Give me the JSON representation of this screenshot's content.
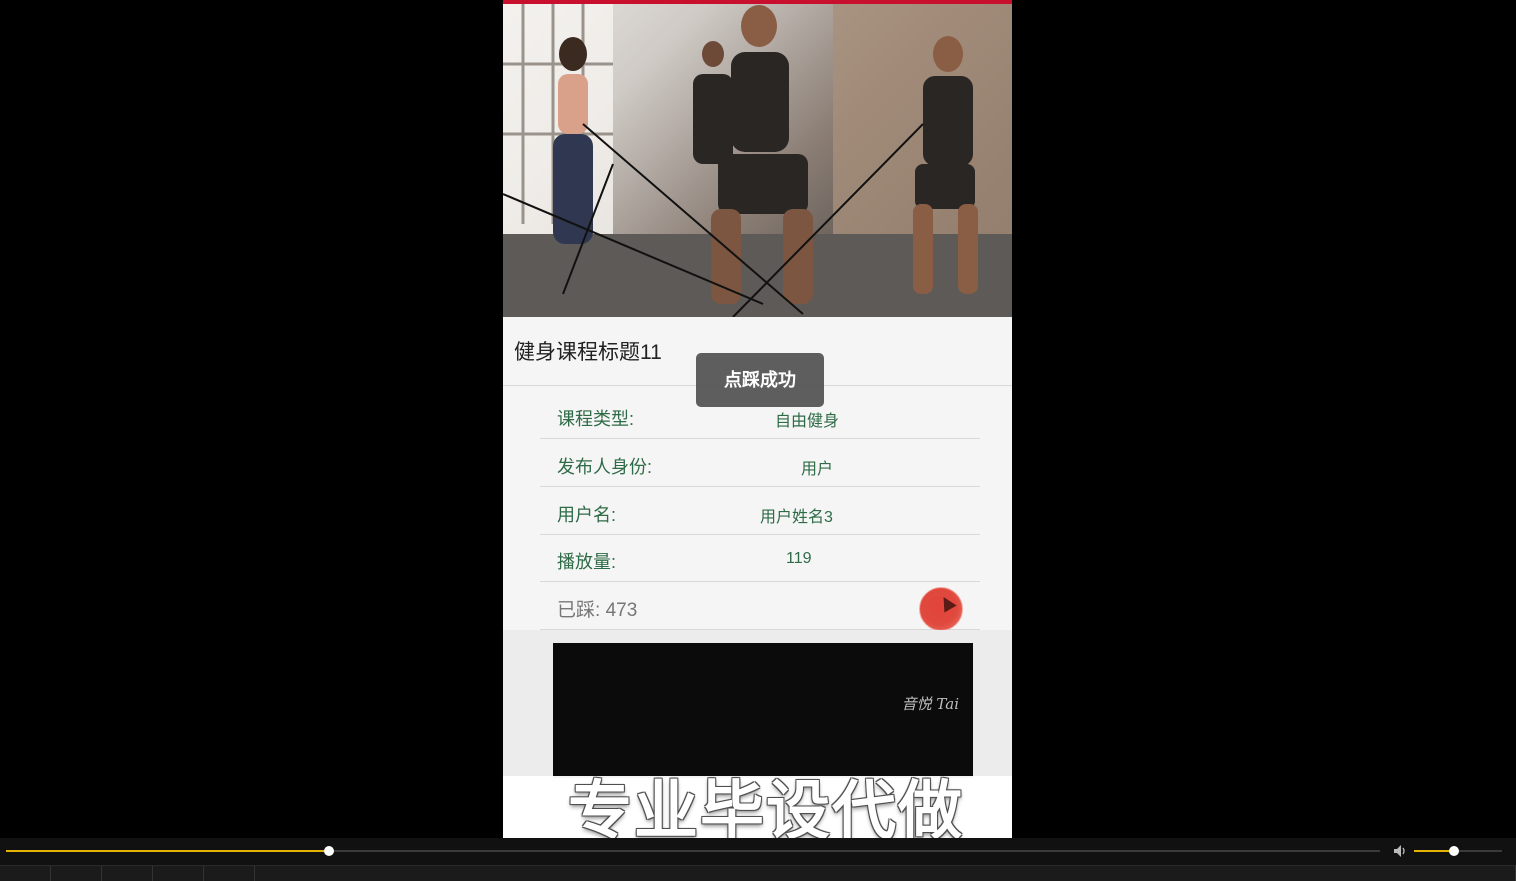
{
  "course": {
    "title": "健身课程标题11"
  },
  "toast": {
    "message": "点踩成功"
  },
  "details": [
    {
      "label": "课程类型:",
      "value": "自由健身"
    },
    {
      "label": "发布人身份:",
      "value": "用户"
    },
    {
      "label": "用户名:",
      "value": "用户姓名3"
    },
    {
      "label": "播放量:",
      "value": "119"
    }
  ],
  "stomp": {
    "label": "已踩:",
    "count": "473"
  },
  "video": {
    "watermark": "音悦 Tai"
  },
  "overlay": {
    "text": "专业毕设代做"
  },
  "player": {
    "progress_fraction": 0.235,
    "volume_fraction": 0.45
  },
  "colors": {
    "accent_red": "#c8102e",
    "detail_text": "#2f6b47",
    "progress": "#e2b300"
  }
}
